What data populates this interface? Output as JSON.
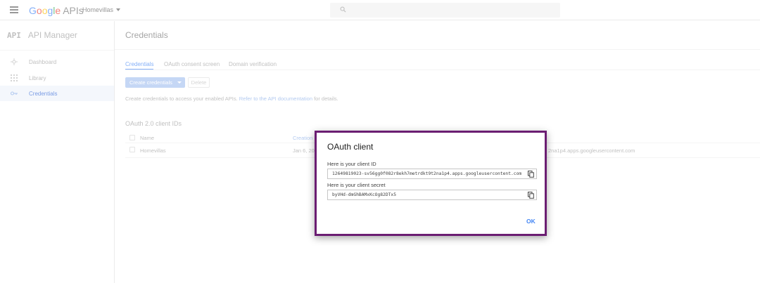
{
  "topbar": {
    "logo_letters": [
      "G",
      "o",
      "o",
      "g",
      "l",
      "e"
    ],
    "logo_suffix": "APIs",
    "project_name": "Homevillas",
    "search_placeholder": ""
  },
  "sidebar": {
    "title": "API Manager",
    "title_mark": "API",
    "items": [
      {
        "label": "Dashboard",
        "icon": "dashboard-icon"
      },
      {
        "label": "Library",
        "icon": "grid-icon"
      },
      {
        "label": "Credentials",
        "icon": "key-icon",
        "active": true
      }
    ]
  },
  "main": {
    "page_title": "Credentials",
    "tabs": [
      {
        "label": "Credentials",
        "active": true
      },
      {
        "label": "OAuth consent screen"
      },
      {
        "label": "Domain verification"
      }
    ],
    "create_button": "Create credentials",
    "delete_button": "Delete",
    "help_prefix": "Create credentials to access your enabled APIs.",
    "help_link": "Refer to the API documentation",
    "help_suffix": "for details.",
    "section_title": "OAuth 2.0 client IDs",
    "columns": {
      "name": "Name",
      "creation": "Creation"
    },
    "row": {
      "name": "Homevillas",
      "date": "Jan 6, 20",
      "client_id_tail": "2na1p4.apps.googleusercontent.com"
    }
  },
  "dialog": {
    "title": "OAuth client",
    "client_id_label": "Here is your client ID",
    "client_id": "12649819023-sv56gg0f082r8ekh7metrdkt9t2na1p4.apps.googleusercontent.com",
    "secret_label": "Here is your client secret",
    "client_secret": "byVHd-dmGhBAMxKcOg82DTx5",
    "ok_label": "OK"
  },
  "colors": {
    "accent": "#4285f4",
    "dialog_border": "#6b1d72"
  }
}
